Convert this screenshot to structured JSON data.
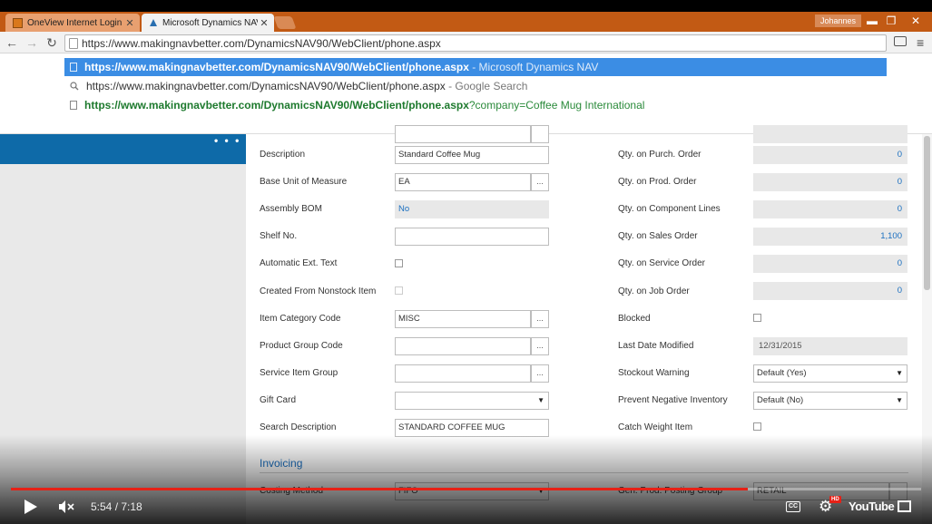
{
  "browser": {
    "tabs": [
      {
        "label": "OneView Internet Login",
        "close": "✕"
      },
      {
        "label": "Microsoft Dynamics NAV",
        "close": "✕"
      }
    ],
    "user": "Johannes",
    "window_controls": {
      "minimize": "▬",
      "maximize": "❐",
      "close": "✕"
    },
    "nav": {
      "back": "←",
      "forward": "→",
      "reload": "↻"
    },
    "address": "https://www.makingnavbetter.com/DynamicsNAV90/WebClient/phone.aspx",
    "menu": "≡",
    "suggestions": [
      {
        "url": "https://www.makingnavbetter.com/DynamicsNAV90/WebClient/phone.aspx",
        "suffix": " - Microsoft Dynamics NAV"
      },
      {
        "url": "https://www.makingnavbetter.com/DynamicsNAV90/WebClient/phone.aspx",
        "suffix": " - Google Search"
      },
      {
        "url": "https://www.makingnavbetter.com/DynamicsNAV90/WebClient/phone.aspx",
        "suffix": "?company=Coffee Mug International"
      }
    ]
  },
  "nav_page": {
    "more_dots": "• • •",
    "left_fields": {
      "description": {
        "label": "Description",
        "value": "Standard Coffee Mug"
      },
      "base_uom": {
        "label": "Base Unit of Measure",
        "value": "EA",
        "lookup": "..."
      },
      "assembly_bom": {
        "label": "Assembly BOM",
        "value": "No"
      },
      "shelf_no": {
        "label": "Shelf No.",
        "value": ""
      },
      "auto_ext_text": {
        "label": "Automatic Ext. Text",
        "checked": false
      },
      "created_nonstock": {
        "label": "Created From Nonstock Item",
        "checked": false
      },
      "item_category": {
        "label": "Item Category Code",
        "value": "MISC",
        "lookup": "..."
      },
      "product_group": {
        "label": "Product Group Code",
        "value": "",
        "lookup": "..."
      },
      "service_item_group": {
        "label": "Service Item Group",
        "value": "",
        "lookup": "..."
      },
      "gift_card": {
        "label": "Gift Card",
        "value": "",
        "arrow": "▼"
      },
      "search_description": {
        "label": "Search Description",
        "value": "STANDARD COFFEE MUG"
      }
    },
    "right_fields": {
      "qty_purch_order": {
        "label": "Qty. on Purch. Order",
        "value": "0"
      },
      "qty_prod_order": {
        "label": "Qty. on Prod. Order",
        "value": "0"
      },
      "qty_component_lines": {
        "label": "Qty. on Component Lines",
        "value": "0"
      },
      "qty_sales_order": {
        "label": "Qty. on Sales Order",
        "value": "1,100"
      },
      "qty_service_order": {
        "label": "Qty. on Service Order",
        "value": "0"
      },
      "qty_job_order": {
        "label": "Qty. on Job Order",
        "value": "0"
      },
      "blocked": {
        "label": "Blocked",
        "checked": false
      },
      "last_date_modified": {
        "label": "Last Date Modified",
        "value": "12/31/2015"
      },
      "stockout_warning": {
        "label": "Stockout Warning",
        "value": "Default (Yes)",
        "arrow": "▼"
      },
      "prevent_negative": {
        "label": "Prevent Negative Inventory",
        "value": "Default (No)",
        "arrow": "▼"
      },
      "catch_weight": {
        "label": "Catch Weight Item",
        "checked": false
      }
    },
    "invoicing": {
      "title": "Invoicing",
      "costing_method": {
        "label": "Costing Method",
        "value": "FIFO"
      },
      "gen_prod_posting": {
        "label": "Gen. Prod. Posting Group",
        "value": "RETAIL"
      }
    }
  },
  "video": {
    "time": "5:54 / 7:18",
    "progress": 0.81,
    "cc": "CC",
    "hd": "HD",
    "gear": "⚙",
    "youtube": "YouTube",
    "volume": "🔇",
    "accent": "#e62117"
  }
}
